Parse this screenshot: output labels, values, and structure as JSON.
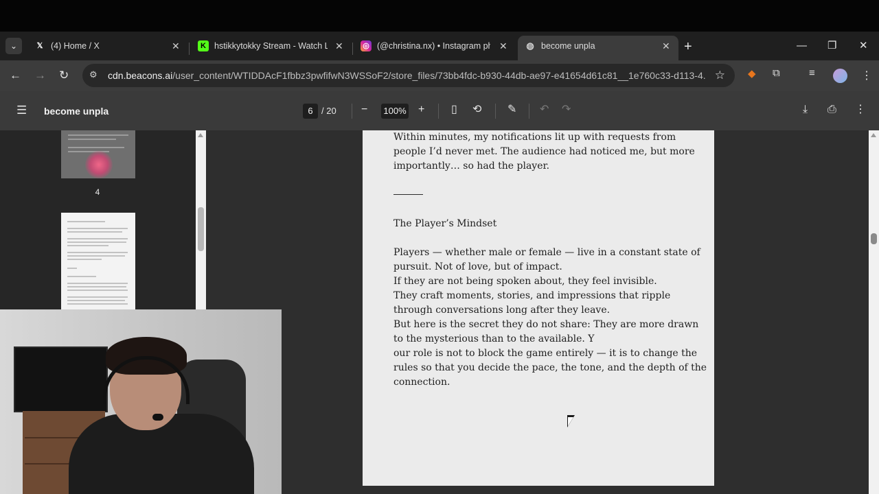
{
  "tabs": [
    {
      "title": "(4) Home / X",
      "favicon": "x-logo-icon"
    },
    {
      "title": "hstikkytokky Stream - Watch Li",
      "favicon": "kick-logo-icon"
    },
    {
      "title": "(@christina.nx) • Instagram pho",
      "favicon": "instagram-logo-icon"
    },
    {
      "title": "become unpla",
      "favicon": "globe-icon"
    }
  ],
  "address": {
    "host": "cdn.beacons.ai",
    "path": "/user_content/WTIDDAcF1fbbz3pwfifwN3WSSoF2/store_files/73bb4fdc-b930-44db-ae97-e41654d61c81__1e760c33-d113-4..."
  },
  "pdf": {
    "title": "become unpla",
    "current_page": "6",
    "total_pages": "/ 20",
    "zoom": "100%",
    "thumb_label": "4",
    "lines": [
      "Within minutes, my notifications lit up with requests from",
      "people I’d never met. The audience had noticed me, but more",
      "importantly… so had the player.",
      " The Player’s Mindset",
      "Players — whether male or female — live in a constant state of",
      "pursuit. Not of love, but of impact.",
      "If they are not being spoken about, they feel invisible.",
      " They craft moments, stories, and impressions that ripple",
      "through conversations long after they leave.",
      " But here is the secret they do not share: They are more drawn",
      "to the mysterious than to the available. Y",
      "our role is not to block the game entirely — it is to change the",
      "rules so that you decide the pace, the tone, and the depth of the",
      "connection."
    ]
  },
  "colors": {
    "tabstrip": "#1f1f1f",
    "toolbar": "#3c3c3c",
    "pdfbar": "#3a3a3a",
    "page": "#ebebeb"
  }
}
